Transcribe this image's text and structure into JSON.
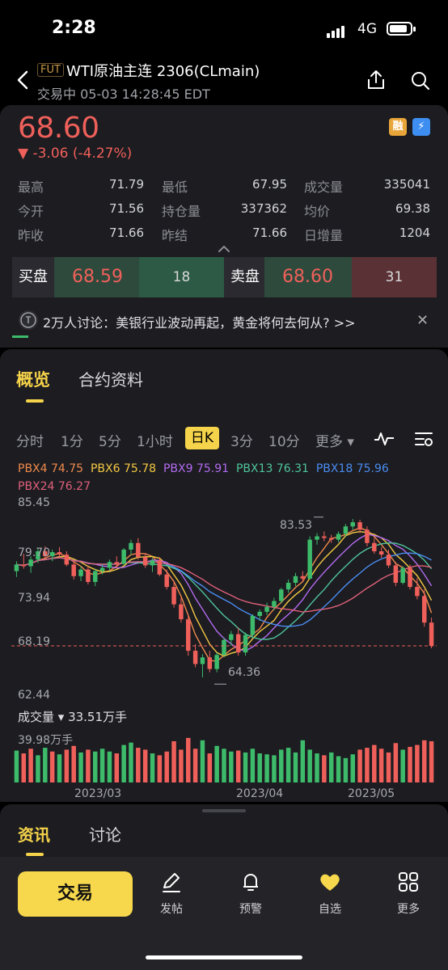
{
  "status_bar": {
    "time": "2:28",
    "network": "4G"
  },
  "header": {
    "tag": "FUT",
    "title": "WTI原油主连 2306(CLmain)",
    "subtitle": "交易中 05-03 14:28:45 EDT"
  },
  "quote": {
    "price": "68.60",
    "change": "▼ -3.06 (-4.27%)",
    "badges": [
      "融",
      "⚡"
    ],
    "stats": [
      {
        "label": "最高",
        "value": "71.79"
      },
      {
        "label": "最低",
        "value": "67.95"
      },
      {
        "label": "成交量",
        "value": "335041"
      },
      {
        "label": "今开",
        "value": "71.56"
      },
      {
        "label": "持仓量",
        "value": "337362"
      },
      {
        "label": "均价",
        "value": "69.38"
      },
      {
        "label": "昨收",
        "value": "71.66"
      },
      {
        "label": "昨结",
        "value": "71.66"
      },
      {
        "label": "日增量",
        "value": "1204"
      }
    ]
  },
  "order_book": {
    "bid_label": "买盘",
    "bid_price": "68.59",
    "bid_qty": "18",
    "ask_label": "卖盘",
    "ask_price": "68.60",
    "ask_qty": "31"
  },
  "news_banner": {
    "text": "2万人讨论：美银行业波动再起，黄金将何去何从? >>"
  },
  "section_tabs": [
    "概览",
    "合约资料"
  ],
  "kline_tabs": [
    "分时",
    "1分",
    "5分",
    "1小时",
    "日K",
    "3分",
    "10分",
    "更多 ▾"
  ],
  "kline_active": "日K",
  "ma_legend": [
    {
      "label": "PBX4 74.75",
      "color": "#f08a4b"
    },
    {
      "label": "PBX6 75.78",
      "color": "#f5c842"
    },
    {
      "label": "PBX9 75.91",
      "color": "#b36bf0"
    },
    {
      "label": "PBX13 76.31",
      "color": "#4fc49a"
    },
    {
      "label": "PBX18 75.96",
      "color": "#4a8cf0"
    },
    {
      "label": "PBX24 76.27",
      "color": "#e0607a"
    }
  ],
  "chart_labels": {
    "y_top": "85.45",
    "y_mid1": "79.70",
    "y_mid2": "73.94",
    "y_last": "68.19",
    "y_bottom": "62.44",
    "high_marker": "83.53",
    "low_marker": "64.36",
    "volume_title": "成交量 ▾  33.51万手",
    "volume_max": "39.98万手",
    "dates": [
      "2023/03",
      "2023/04",
      "2023/05"
    ]
  },
  "chart_data": {
    "type": "candlestick",
    "ylim": [
      62.44,
      85.45
    ],
    "last_price": 68.19,
    "high": 83.53,
    "low": 64.36,
    "candles": [
      [
        77.2,
        78.4,
        76.5,
        78.0
      ],
      [
        78.0,
        79.3,
        77.5,
        77.8
      ],
      [
        77.8,
        79.0,
        77.0,
        78.6
      ],
      [
        78.6,
        80.0,
        78.2,
        79.6
      ],
      [
        79.6,
        80.2,
        78.8,
        79.0
      ],
      [
        79.0,
        79.8,
        78.4,
        79.5
      ],
      [
        79.5,
        80.1,
        78.9,
        79.2
      ],
      [
        79.2,
        79.6,
        77.8,
        78.0
      ],
      [
        78.0,
        78.4,
        76.2,
        76.6
      ],
      [
        76.6,
        77.8,
        76.0,
        77.4
      ],
      [
        77.4,
        77.9,
        75.6,
        75.9
      ],
      [
        75.9,
        77.5,
        75.4,
        77.2
      ],
      [
        77.2,
        78.0,
        76.8,
        77.6
      ],
      [
        77.6,
        78.6,
        77.2,
        78.3
      ],
      [
        78.3,
        79.0,
        77.6,
        78.1
      ],
      [
        78.1,
        80.0,
        77.9,
        79.8
      ],
      [
        79.8,
        81.0,
        79.2,
        80.6
      ],
      [
        80.6,
        81.2,
        78.6,
        78.9
      ],
      [
        78.9,
        79.4,
        77.6,
        77.9
      ],
      [
        77.9,
        78.8,
        77.1,
        78.5
      ],
      [
        78.5,
        78.9,
        76.6,
        76.8
      ],
      [
        76.8,
        77.4,
        75.0,
        75.3
      ],
      [
        75.3,
        75.9,
        72.8,
        73.2
      ],
      [
        73.2,
        74.0,
        71.0,
        71.4
      ],
      [
        71.4,
        72.0,
        67.0,
        67.6
      ],
      [
        67.6,
        68.4,
        65.6,
        66.0
      ],
      [
        66.0,
        67.2,
        64.4,
        66.8
      ],
      [
        66.8,
        67.6,
        65.0,
        65.4
      ],
      [
        65.4,
        67.4,
        65.0,
        67.1
      ],
      [
        67.1,
        69.2,
        66.8,
        68.9
      ],
      [
        68.9,
        70.0,
        68.2,
        69.6
      ],
      [
        69.6,
        70.4,
        67.0,
        67.4
      ],
      [
        67.4,
        69.8,
        67.0,
        69.5
      ],
      [
        69.5,
        72.0,
        69.2,
        71.8
      ],
      [
        71.8,
        72.6,
        71.2,
        72.3
      ],
      [
        72.3,
        73.4,
        71.9,
        72.9
      ],
      [
        72.9,
        74.0,
        72.5,
        73.6
      ],
      [
        73.6,
        75.2,
        73.3,
        75.0
      ],
      [
        75.0,
        76.2,
        74.6,
        75.8
      ],
      [
        75.8,
        77.0,
        75.4,
        76.6
      ],
      [
        76.6,
        77.2,
        75.9,
        76.3
      ],
      [
        76.3,
        81.4,
        76.2,
        81.0
      ],
      [
        81.0,
        81.8,
        80.4,
        81.4
      ],
      [
        81.4,
        82.0,
        80.8,
        81.2
      ],
      [
        81.2,
        81.6,
        80.6,
        81.0
      ],
      [
        81.0,
        82.0,
        80.7,
        81.7
      ],
      [
        81.7,
        82.9,
        81.3,
        82.6
      ],
      [
        82.6,
        83.5,
        82.2,
        83.1
      ],
      [
        83.1,
        83.4,
        81.8,
        82.2
      ],
      [
        82.2,
        82.6,
        80.2,
        80.6
      ],
      [
        80.6,
        81.2,
        79.3,
        79.6
      ],
      [
        79.6,
        80.1,
        78.8,
        79.2
      ],
      [
        79.2,
        79.8,
        77.6,
        77.9
      ],
      [
        77.9,
        78.3,
        75.4,
        75.8
      ],
      [
        75.8,
        77.8,
        75.6,
        77.6
      ],
      [
        77.6,
        78.0,
        75.0,
        75.3
      ],
      [
        75.3,
        76.4,
        73.8,
        74.2
      ],
      [
        74.2,
        75.0,
        70.5,
        71.0
      ],
      [
        71.0,
        71.6,
        67.9,
        68.2
      ]
    ],
    "volume": [
      {
        "v": 0.68,
        "up": 1
      },
      {
        "v": 0.62,
        "up": 0
      },
      {
        "v": 0.72,
        "up": 0
      },
      {
        "v": 0.58,
        "up": 1
      },
      {
        "v": 0.74,
        "up": 1
      },
      {
        "v": 0.66,
        "up": 0
      },
      {
        "v": 0.6,
        "up": 1
      },
      {
        "v": 0.7,
        "up": 0
      },
      {
        "v": 0.78,
        "up": 0
      },
      {
        "v": 0.64,
        "up": 1
      },
      {
        "v": 0.7,
        "up": 0
      },
      {
        "v": 0.66,
        "up": 1
      },
      {
        "v": 0.72,
        "up": 1
      },
      {
        "v": 0.66,
        "up": 1
      },
      {
        "v": 0.62,
        "up": 0
      },
      {
        "v": 0.8,
        "up": 1
      },
      {
        "v": 0.85,
        "up": 1
      },
      {
        "v": 0.74,
        "up": 0
      },
      {
        "v": 0.7,
        "up": 0
      },
      {
        "v": 0.62,
        "up": 1
      },
      {
        "v": 0.58,
        "up": 0
      },
      {
        "v": 0.66,
        "up": 0
      },
      {
        "v": 0.88,
        "up": 0
      },
      {
        "v": 0.7,
        "up": 0
      },
      {
        "v": 0.95,
        "up": 0
      },
      {
        "v": 0.72,
        "up": 0
      },
      {
        "v": 0.9,
        "up": 1
      },
      {
        "v": 0.62,
        "up": 0
      },
      {
        "v": 0.78,
        "up": 1
      },
      {
        "v": 0.72,
        "up": 1
      },
      {
        "v": 0.66,
        "up": 1
      },
      {
        "v": 0.68,
        "up": 0
      },
      {
        "v": 0.64,
        "up": 1
      },
      {
        "v": 0.72,
        "up": 1
      },
      {
        "v": 0.62,
        "up": 1
      },
      {
        "v": 0.6,
        "up": 1
      },
      {
        "v": 0.58,
        "up": 1
      },
      {
        "v": 0.7,
        "up": 1
      },
      {
        "v": 0.74,
        "up": 1
      },
      {
        "v": 0.64,
        "up": 1
      },
      {
        "v": 0.9,
        "up": 1
      },
      {
        "v": 0.7,
        "up": 1
      },
      {
        "v": 0.62,
        "up": 1
      },
      {
        "v": 0.58,
        "up": 0
      },
      {
        "v": 0.64,
        "up": 1
      },
      {
        "v": 0.56,
        "up": 1
      },
      {
        "v": 0.52,
        "up": 1
      },
      {
        "v": 0.6,
        "up": 1
      },
      {
        "v": 0.7,
        "up": 0
      },
      {
        "v": 0.74,
        "up": 0
      },
      {
        "v": 0.8,
        "up": 0
      },
      {
        "v": 0.72,
        "up": 0
      },
      {
        "v": 0.64,
        "up": 0
      },
      {
        "v": 0.84,
        "up": 0
      },
      {
        "v": 0.7,
        "up": 1
      },
      {
        "v": 0.76,
        "up": 0
      },
      {
        "v": 0.8,
        "up": 0
      },
      {
        "v": 0.9,
        "up": 0
      },
      {
        "v": 0.88,
        "up": 0
      }
    ]
  },
  "bottom_tabs": [
    "资讯",
    "讨论"
  ],
  "nav": {
    "trade": "交易",
    "items": [
      "发帖",
      "预警",
      "自选",
      "更多"
    ]
  },
  "colors": {
    "up": "#3dbb6b",
    "down": "#f0605a",
    "accent": "#f5d34a"
  }
}
